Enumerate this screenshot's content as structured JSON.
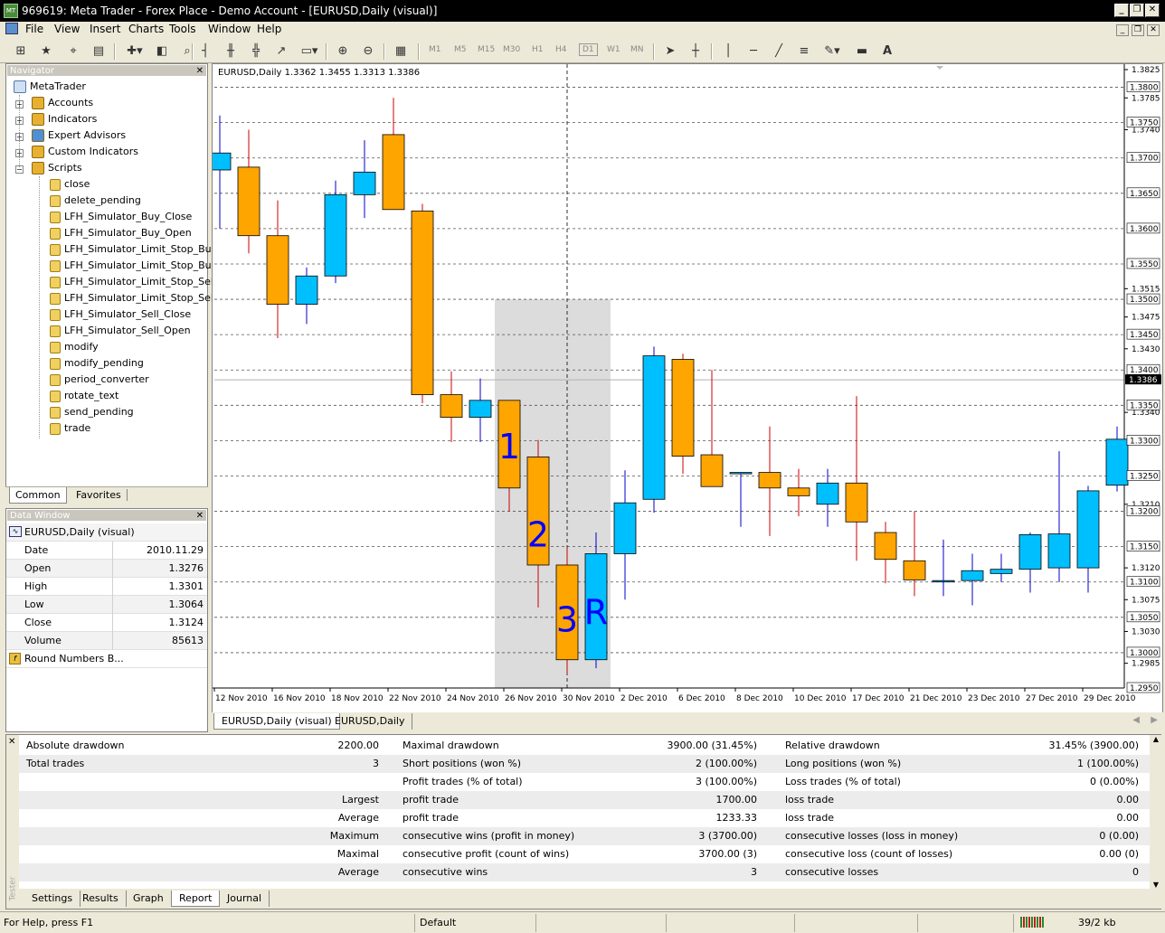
{
  "app": {
    "title": "969619: Meta Trader - Forex Place - Demo Account - [EURUSD,Daily (visual)]",
    "logo_text": "MT"
  },
  "menu": [
    "File",
    "View",
    "Insert",
    "Charts",
    "Tools",
    "Window",
    "Help"
  ],
  "toolbar": {
    "timeframes": [
      "M1",
      "M5",
      "M15",
      "M30",
      "H1",
      "H4",
      "D1",
      "W1",
      "MN"
    ],
    "active_timeframe": "D1",
    "text_tool": "A"
  },
  "navigator": {
    "title": "Navigator",
    "root": "MetaTrader",
    "folders": [
      "Accounts",
      "Indicators",
      "Expert Advisors",
      "Custom Indicators",
      "Scripts"
    ],
    "scripts": [
      "close",
      "delete_pending",
      "LFH_Simulator_Buy_Close",
      "LFH_Simulator_Buy_Open",
      "LFH_Simulator_Limit_Stop_Buy",
      "LFH_Simulator_Limit_Stop_Buy_",
      "LFH_Simulator_Limit_Stop_Sell",
      "LFH_Simulator_Limit_Stop_Sell_",
      "LFH_Simulator_Sell_Close",
      "LFH_Simulator_Sell_Open",
      "modify",
      "modify_pending",
      "period_converter",
      "rotate_text",
      "send_pending",
      "trade"
    ],
    "tabs": [
      "Common",
      "Favorites"
    ],
    "active_tab": "Common"
  },
  "data_window": {
    "title": "Data Window",
    "symbol": "EURUSD,Daily (visual)",
    "rows": [
      {
        "label": "Date",
        "value": "2010.11.29"
      },
      {
        "label": "Open",
        "value": "1.3276"
      },
      {
        "label": "High",
        "value": "1.3301"
      },
      {
        "label": "Low",
        "value": "1.3064"
      },
      {
        "label": "Close",
        "value": "1.3124"
      },
      {
        "label": "Volume",
        "value": "85613"
      }
    ],
    "indicator": "Round Numbers B..."
  },
  "chart": {
    "header": "EURUSD,Daily  1.3362 1.3455 1.3313 1.3386",
    "tabs": [
      "EURUSD,Daily (visual)",
      "EURUSD,Daily"
    ],
    "active_tab": "EURUSD,Daily"
  },
  "chart_data": {
    "type": "candlestick",
    "symbol": "EURUSD",
    "ylim": [
      1.295,
      1.3825
    ],
    "y_ticks_plain": [
      "1.3825",
      "1.3785",
      "1.3740",
      "1.3515",
      "1.3475",
      "1.3430",
      "1.3340",
      "1.3210",
      "1.3120",
      "1.3075",
      "1.3030",
      "1.2985"
    ],
    "y_ticks_boxed": [
      "1.3800",
      "1.3750",
      "1.3700",
      "1.3650",
      "1.3600",
      "1.3550",
      "1.3500",
      "1.3450",
      "1.3400",
      "1.3350",
      "1.3300",
      "1.3250",
      "1.3200",
      "1.3150",
      "1.3100",
      "1.3050",
      "1.3000",
      "1.2950"
    ],
    "current_price": "1.3386",
    "x_labels": [
      "12 Nov 2010",
      "16 Nov 2010",
      "18 Nov 2010",
      "22 Nov 2010",
      "24 Nov 2010",
      "26 Nov 2010",
      "30 Nov 2010",
      "2 Dec 2010",
      "6 Dec 2010",
      "8 Dec 2010",
      "10 Dec 2010",
      "17 Dec 2010",
      "21 Dec 2010",
      "23 Dec 2010",
      "27 Dec 2010",
      "29 Dec 2010"
    ],
    "bull_color": "#00bfff",
    "bear_color": "#ffa500",
    "shaded_range_color": "#dcdcdc",
    "candles": [
      {
        "o": 1.3683,
        "h": 1.376,
        "l": 1.36,
        "c": 1.3707
      },
      {
        "o": 1.3687,
        "h": 1.374,
        "l": 1.3565,
        "c": 1.359
      },
      {
        "o": 1.359,
        "h": 1.364,
        "l": 1.3445,
        "c": 1.3493
      },
      {
        "o": 1.3493,
        "h": 1.3545,
        "l": 1.3465,
        "c": 1.3533
      },
      {
        "o": 1.3533,
        "h": 1.3668,
        "l": 1.3523,
        "c": 1.3648
      },
      {
        "o": 1.3648,
        "h": 1.3725,
        "l": 1.3615,
        "c": 1.368
      },
      {
        "o": 1.3733,
        "h": 1.3785,
        "l": 1.3635,
        "c": 1.3627
      },
      {
        "o": 1.3625,
        "h": 1.3635,
        "l": 1.3353,
        "c": 1.3365
      },
      {
        "o": 1.3365,
        "h": 1.3398,
        "l": 1.3298,
        "c": 1.3333
      },
      {
        "o": 1.3333,
        "h": 1.3388,
        "l": 1.3298,
        "c": 1.3357
      },
      {
        "o": 1.3357,
        "h": 1.3357,
        "l": 1.32,
        "c": 1.3233
      },
      {
        "o": 1.3277,
        "h": 1.3301,
        "l": 1.3064,
        "c": 1.3124
      },
      {
        "o": 1.3124,
        "h": 1.3148,
        "l": 1.297,
        "c": 1.299
      },
      {
        "o": 1.299,
        "h": 1.317,
        "l": 1.2978,
        "c": 1.314
      },
      {
        "o": 1.314,
        "h": 1.3258,
        "l": 1.3075,
        "c": 1.3212
      },
      {
        "o": 1.3217,
        "h": 1.3433,
        "l": 1.3198,
        "c": 1.342
      },
      {
        "o": 1.3415,
        "h": 1.3423,
        "l": 1.3253,
        "c": 1.3278
      },
      {
        "o": 1.328,
        "h": 1.34,
        "l": 1.3238,
        "c": 1.3235
      },
      {
        "o": 1.3255,
        "h": 1.3255,
        "l": 1.3178,
        "c": 1.3255
      },
      {
        "o": 1.3255,
        "h": 1.332,
        "l": 1.3165,
        "c": 1.3233
      },
      {
        "o": 1.3233,
        "h": 1.326,
        "l": 1.3193,
        "c": 1.3222
      },
      {
        "o": 1.321,
        "h": 1.326,
        "l": 1.3178,
        "c": 1.324
      },
      {
        "o": 1.324,
        "h": 1.3363,
        "l": 1.313,
        "c": 1.3185
      },
      {
        "o": 1.317,
        "h": 1.3185,
        "l": 1.3098,
        "c": 1.3132
      },
      {
        "o": 1.313,
        "h": 1.32,
        "l": 1.308,
        "c": 1.3103
      },
      {
        "o": 1.3102,
        "h": 1.316,
        "l": 1.308,
        "c": 1.3102
      },
      {
        "o": 1.3102,
        "h": 1.314,
        "l": 1.3067,
        "c": 1.3116
      },
      {
        "o": 1.3112,
        "h": 1.314,
        "l": 1.31,
        "c": 1.3118
      },
      {
        "o": 1.3118,
        "h": 1.317,
        "l": 1.3085,
        "c": 1.3167
      },
      {
        "o": 1.312,
        "h": 1.3285,
        "l": 1.31,
        "c": 1.3168
      },
      {
        "o": 1.312,
        "h": 1.3236,
        "l": 1.3085,
        "c": 1.3229
      },
      {
        "o": 1.3237,
        "h": 1.332,
        "l": 1.3228,
        "c": 1.3302
      }
    ],
    "annotations": [
      {
        "text": "1",
        "candle": 10,
        "price": 1.3275,
        "color": "#0000ff"
      },
      {
        "text": "2",
        "candle": 11,
        "price": 1.315,
        "color": "#0000ff"
      },
      {
        "text": "3",
        "candle": 12,
        "price": 1.303,
        "color": "#0000ff"
      },
      {
        "text": "R",
        "candle": 13,
        "price": 1.304,
        "color": "#0000ff"
      }
    ],
    "shaded_candle_range": [
      10,
      13
    ],
    "crosshair_candle": 12
  },
  "tester": {
    "side_label": "Tester",
    "rows": [
      {
        "c1": "Absolute drawdown",
        "v1": "2200.00",
        "c2": "Maximal drawdown",
        "v2": "3900.00 (31.45%)",
        "c3": "Relative drawdown",
        "v3": "31.45% (3900.00)"
      },
      {
        "c1": "Total trades",
        "v1": "3",
        "c2": "Short positions (won %)",
        "v2": "2 (100.00%)",
        "c3": "Long positions (won %)",
        "v3": "1 (100.00%)"
      },
      {
        "c1": "",
        "v1": "",
        "c2": "Profit trades (% of total)",
        "v2": "3 (100.00%)",
        "c3": "Loss trades (% of total)",
        "v3": "0 (0.00%)"
      },
      {
        "c1": "",
        "v1": "Largest",
        "c2": "profit trade",
        "v2": "1700.00",
        "c3": "loss trade",
        "v3": "0.00"
      },
      {
        "c1": "",
        "v1": "Average",
        "c2": "profit trade",
        "v2": "1233.33",
        "c3": "loss trade",
        "v3": "0.00"
      },
      {
        "c1": "",
        "v1": "Maximum",
        "c2": "consecutive wins (profit in money)",
        "v2": "3 (3700.00)",
        "c3": "consecutive losses (loss in money)",
        "v3": "0 (0.00)"
      },
      {
        "c1": "",
        "v1": "Maximal",
        "c2": "consecutive profit (count of wins)",
        "v2": "3700.00 (3)",
        "c3": "consecutive loss (count of losses)",
        "v3": "0.00 (0)"
      },
      {
        "c1": "",
        "v1": "Average",
        "c2": "consecutive wins",
        "v2": "3",
        "c3": "consecutive losses",
        "v3": "0"
      }
    ],
    "tabs": [
      "Settings",
      "Results",
      "Graph",
      "Report",
      "Journal"
    ],
    "active_tab": "Report"
  },
  "status": {
    "help": "For Help, press F1",
    "profile": "Default",
    "traffic": "39/2 kb"
  }
}
